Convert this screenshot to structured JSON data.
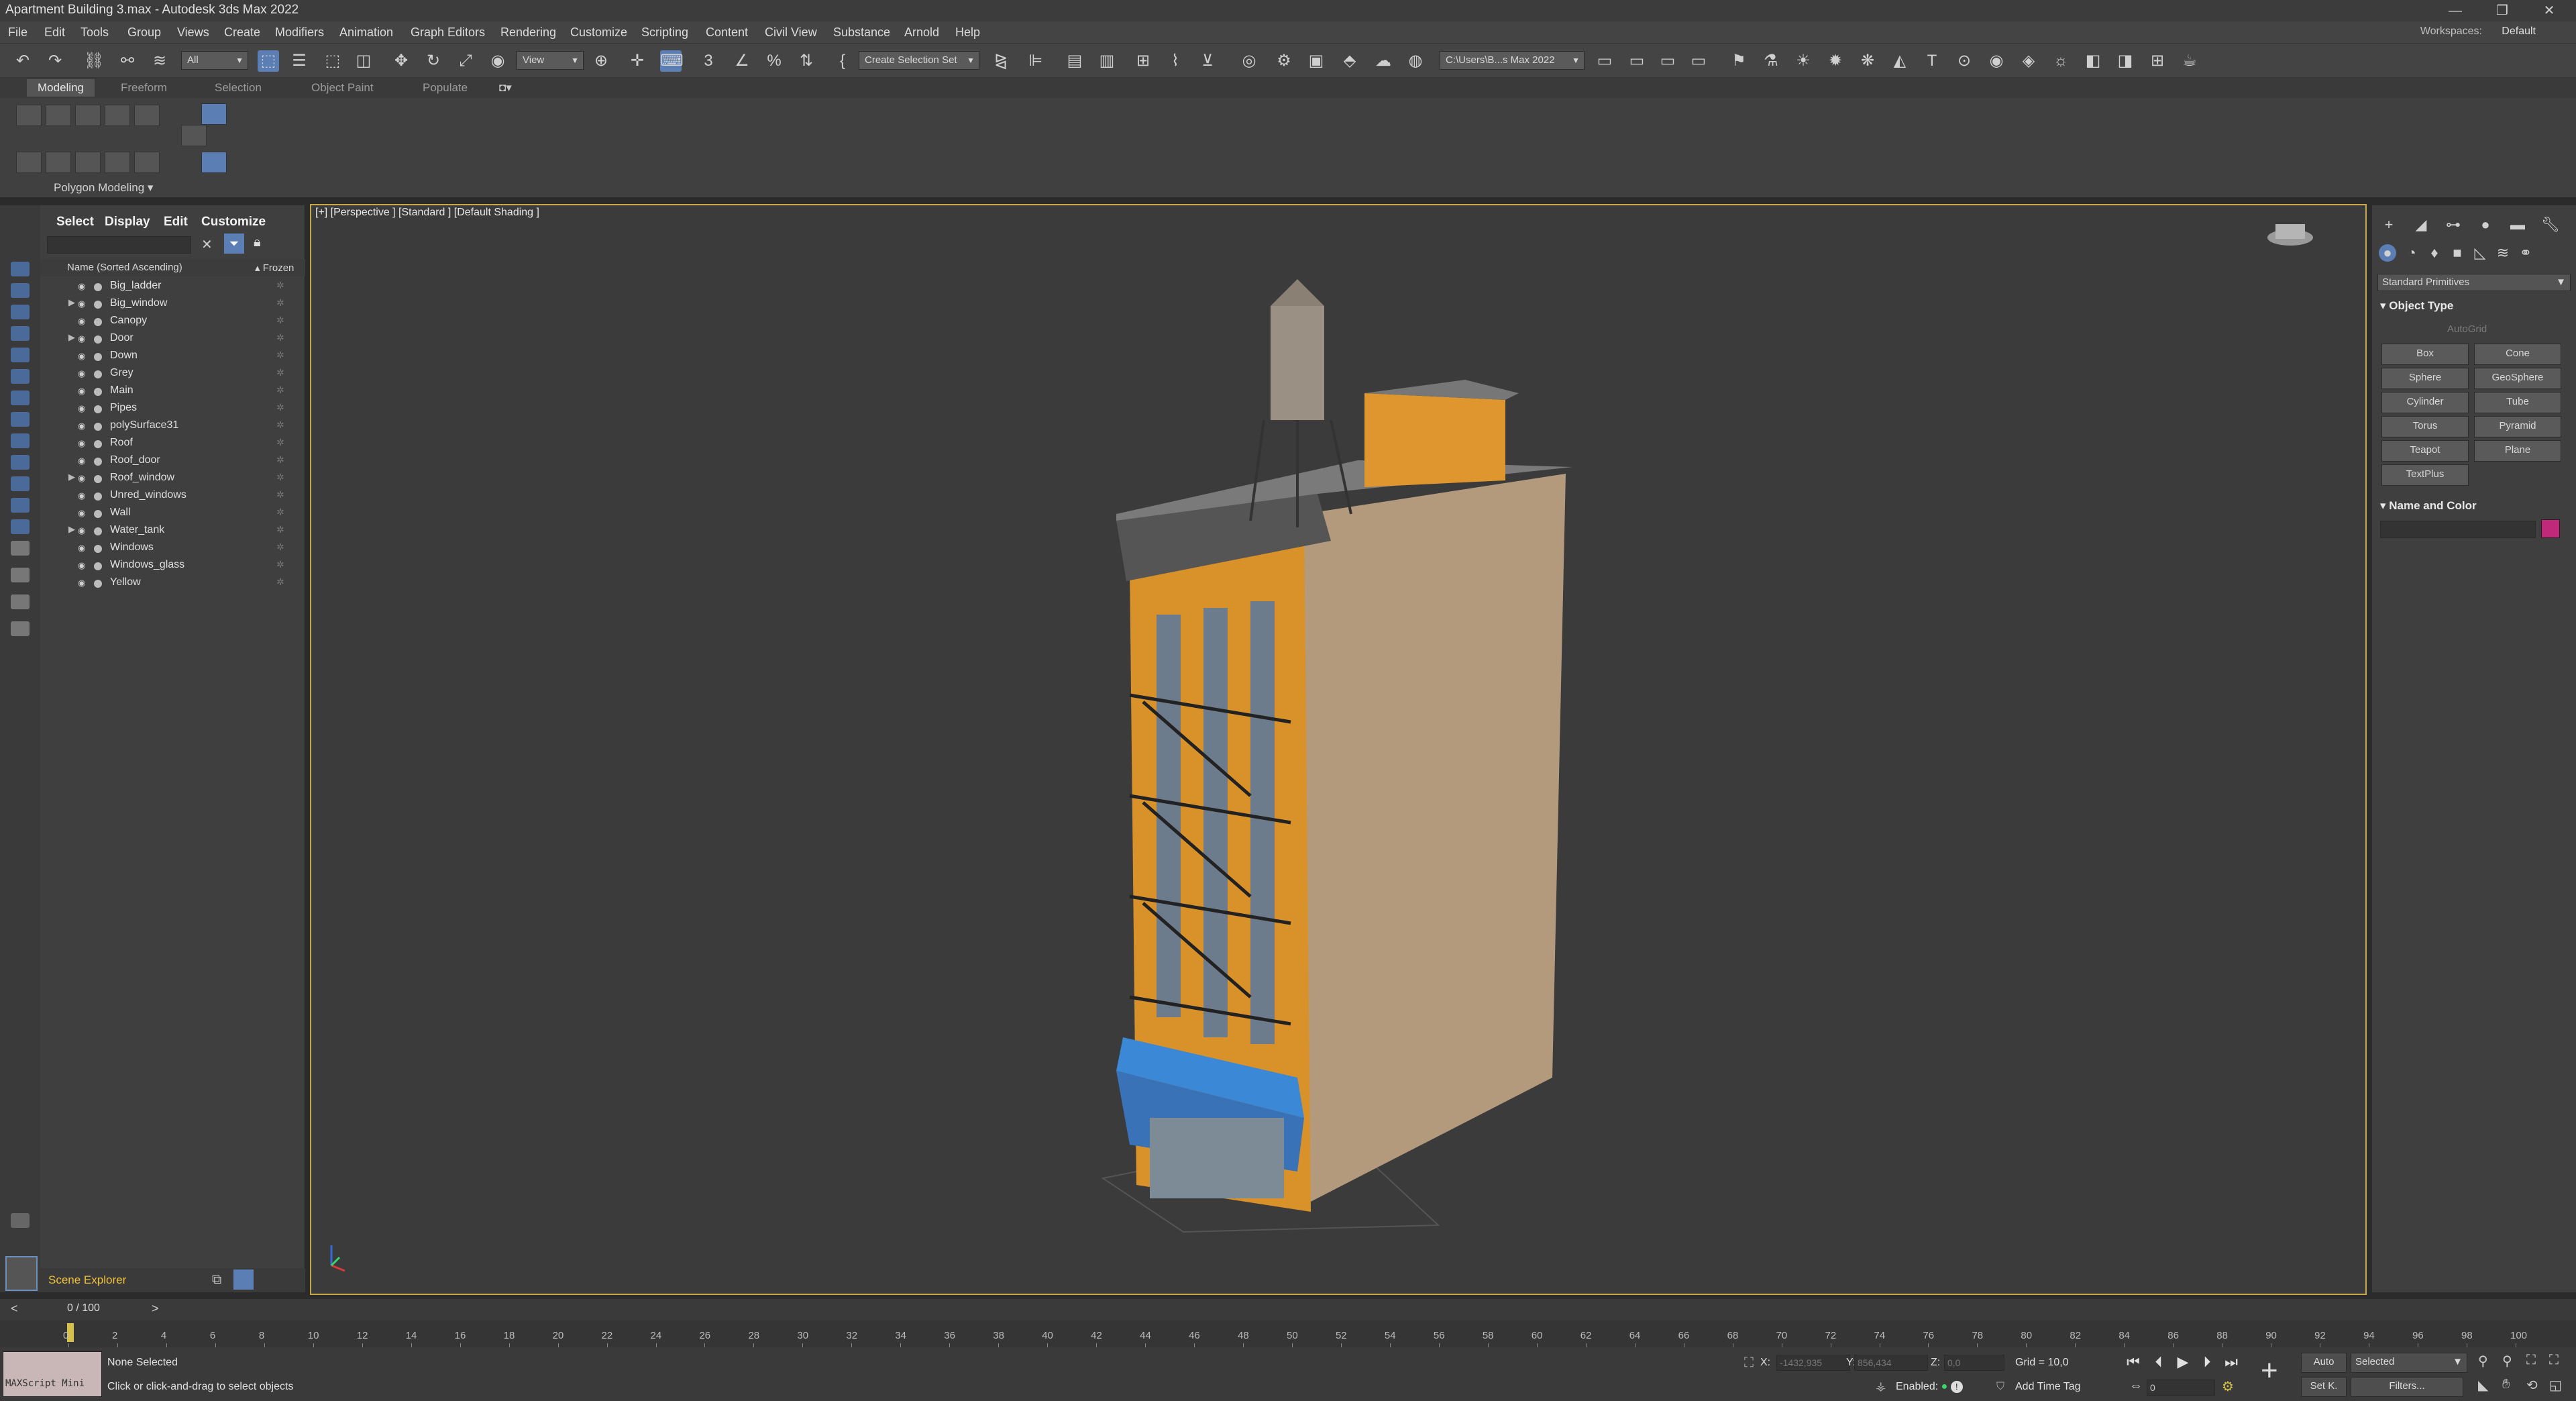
{
  "window": {
    "title": "Apartment Building 3.max - Autodesk 3ds Max 2022",
    "controls": [
      "—",
      "❐",
      "✕"
    ]
  },
  "menu": {
    "items": [
      "File",
      "Edit",
      "Tools",
      "Group",
      "Views",
      "Create",
      "Modifiers",
      "Animation",
      "Graph Editors",
      "Rendering",
      "Customize",
      "Scripting",
      "Content",
      "Civil View",
      "Substance",
      "Arnold",
      "Help"
    ],
    "workspace_label": "Workspaces:",
    "workspace_value": "Default"
  },
  "toolbar": {
    "selection_filter": "All",
    "ref_coord": "View",
    "named_selection": "Create Selection Set",
    "project_path": "C:\\Users\\B...s Max 2022"
  },
  "ribbon": {
    "tabs": [
      "Modeling",
      "Freeform",
      "Selection",
      "Object Paint",
      "Populate"
    ],
    "active_tab": "Modeling",
    "panel_label": "Polygon Modeling"
  },
  "explorer": {
    "menus": [
      "Select",
      "Display",
      "Edit",
      "Customize"
    ],
    "col_name": "Name (Sorted Ascending)",
    "col_frozen": "▴ Frozen",
    "objects": [
      {
        "name": "Big_ladder",
        "expandable": false
      },
      {
        "name": "Big_window",
        "expandable": true
      },
      {
        "name": "Canopy",
        "expandable": false
      },
      {
        "name": "Door",
        "expandable": true
      },
      {
        "name": "Down",
        "expandable": false
      },
      {
        "name": "Grey",
        "expandable": false
      },
      {
        "name": "Main",
        "expandable": false
      },
      {
        "name": "Pipes",
        "expandable": false
      },
      {
        "name": "polySurface31",
        "expandable": false
      },
      {
        "name": "Roof",
        "expandable": false
      },
      {
        "name": "Roof_door",
        "expandable": false
      },
      {
        "name": "Roof_window",
        "expandable": true
      },
      {
        "name": "Unred_windows",
        "expandable": false
      },
      {
        "name": "Wall",
        "expandable": false
      },
      {
        "name": "Water_tank",
        "expandable": true
      },
      {
        "name": "Windows",
        "expandable": false
      },
      {
        "name": "Windows_glass",
        "expandable": false
      },
      {
        "name": "Yellow",
        "expandable": false
      }
    ],
    "footer_label": "Scene Explorer"
  },
  "viewport": {
    "label": "[+] [Perspective ] [Standard ] [Default Shading ]"
  },
  "command_panel": {
    "category": "Standard Primitives",
    "object_type_header": "Object Type",
    "autogrid": "AutoGrid",
    "primitives": [
      "Box",
      "Cone",
      "Sphere",
      "GeoSphere",
      "Cylinder",
      "Tube",
      "Torus",
      "Pyramid",
      "Teapot",
      "Plane",
      "TextPlus"
    ],
    "name_color_header": "Name and Color",
    "object_color": "#c0287a"
  },
  "timeline": {
    "frame_label": "0 / 100",
    "ticks": [
      "0",
      "2",
      "4",
      "6",
      "8",
      "10",
      "12",
      "14",
      "16",
      "18",
      "20",
      "22",
      "24",
      "26",
      "28",
      "30",
      "32",
      "34",
      "36",
      "38",
      "40",
      "42",
      "44",
      "46",
      "48",
      "50",
      "52",
      "54",
      "56",
      "58",
      "60",
      "62",
      "64",
      "66",
      "68",
      "70",
      "72",
      "74",
      "76",
      "78",
      "80",
      "82",
      "84",
      "86",
      "88",
      "90",
      "92",
      "94",
      "96",
      "98",
      "100"
    ]
  },
  "status": {
    "maxscript_label": "MAXScript Mini",
    "selection": "None Selected",
    "prompt": "Click or click-and-drag to select objects",
    "x_label": "X:",
    "x_value": "-1432,935",
    "y_label": "Y:",
    "y_value": "856,434",
    "z_label": "Z:",
    "z_value": "0,0",
    "grid": "Grid = 10,0",
    "enabled_label": "Enabled:",
    "add_time_tag": "Add Time Tag",
    "auto_key": "Auto",
    "set_key": "Set K.",
    "key_filter": "Selected",
    "filters": "Filters...",
    "current_frame": "0"
  }
}
